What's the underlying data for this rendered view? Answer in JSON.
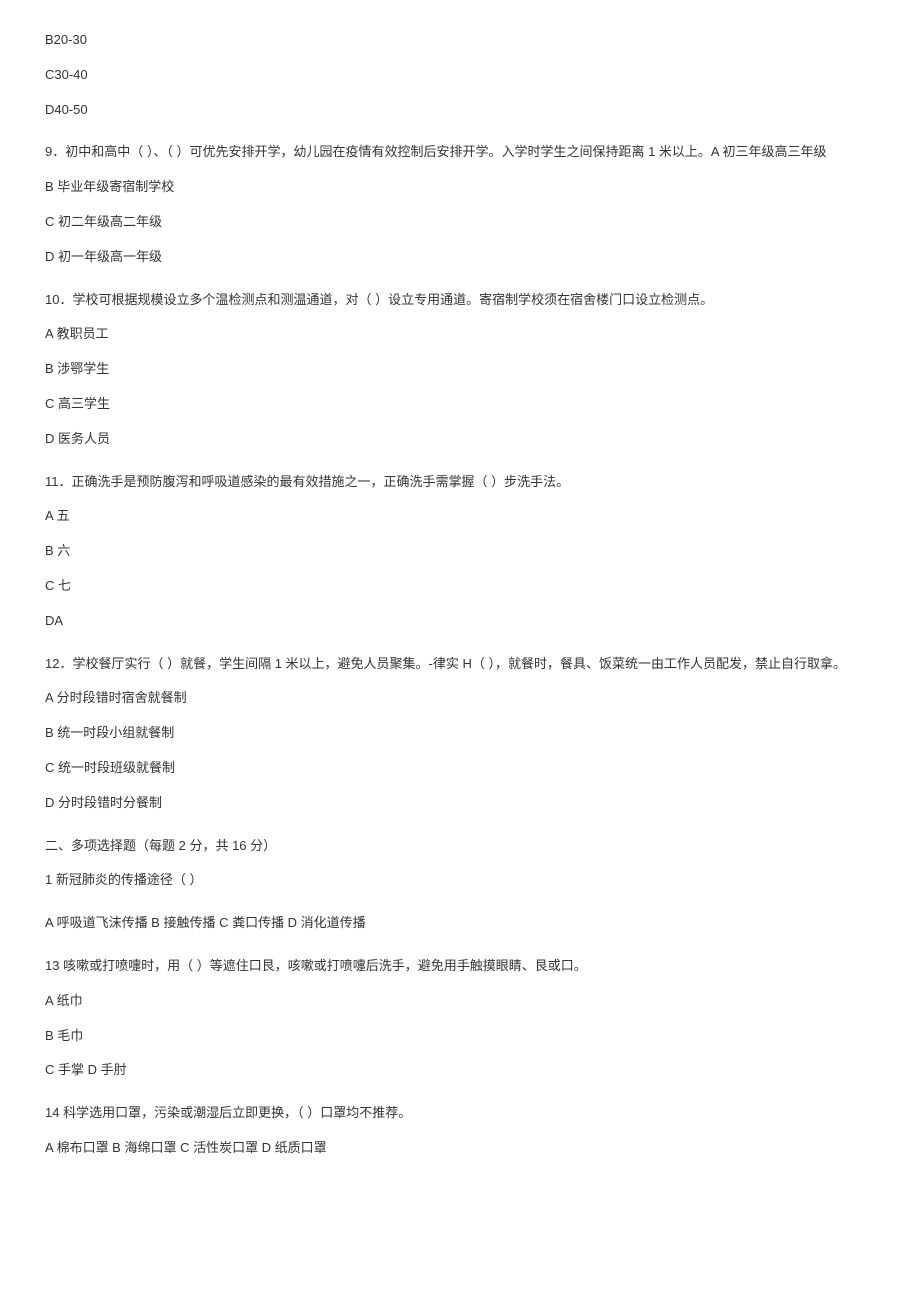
{
  "prelude_options": [
    "B20-30",
    "C30-40",
    "D40-50"
  ],
  "questions": [
    {
      "number": "9",
      "text": "．初中和高中（ ）、（ ）可优先安排开学，幼儿园在疫情有效控制后安排开学。入学时学生之间保持距离 1 米以上。A 初三年级高三年级",
      "options": [
        "B 毕业年级寄宿制学校",
        "C 初二年级高二年级",
        "D 初一年级高一年级"
      ]
    },
    {
      "number": "10",
      "text": "．学校可根据规模设立多个温检测点和测温通道，对（ ）设立专用通道。寄宿制学校须在宿舍楼门口设立检测点。",
      "options": [
        "A 教职员工",
        "B 涉鄂学生",
        "C 高三学生",
        "D 医务人员"
      ]
    },
    {
      "number": "11",
      "text": "．正确洗手是预防腹泻和呼吸道感染的最有效措施之一，正确洗手需掌握（ ）步洗手法。",
      "options": [
        "A 五",
        "B 六",
        "C 七",
        "DA"
      ]
    },
    {
      "number": "12",
      "text": "．学校餐厅实行（ ）就餐，学生间隔 1 米以上，避免人员聚集。-律实 H（ ），就餐时，餐具、饭菜统一由工作人员配发，禁止自行取拿。",
      "options": [
        "A 分时段错时宿舍就餐制",
        "B 统一时段小组就餐制",
        "C 统一时段班级就餐制",
        "D 分时段错时分餐制"
      ]
    }
  ],
  "section2": {
    "header": "二、多项选择题（每题 2 分，共 16 分）",
    "q1": {
      "text": "1 新冠肺炎的传播途径（ ）",
      "options_line": "A 呼吸道飞沫传播 B 接触传播 C 粪口传播 D 消化道传播"
    },
    "q13": {
      "number": "13",
      "text": " 咳嗽或打喷嚏时，用（ ）等遮住口艮，咳嗽或打喷嚏后洗手，避免用手触摸眼睛、艮或口。",
      "options": [
        "A 纸巾",
        "B 毛巾",
        "C 手掌 D 手肘"
      ]
    },
    "q14": {
      "number": "14",
      "text": " 科学选用口罩，污染或潮湿后立即更换，（ ）口罩均不推荐。",
      "options_line": "A 棉布口罩 B 海绵口罩 C 活性炭口罩 D 纸质口罩"
    }
  }
}
